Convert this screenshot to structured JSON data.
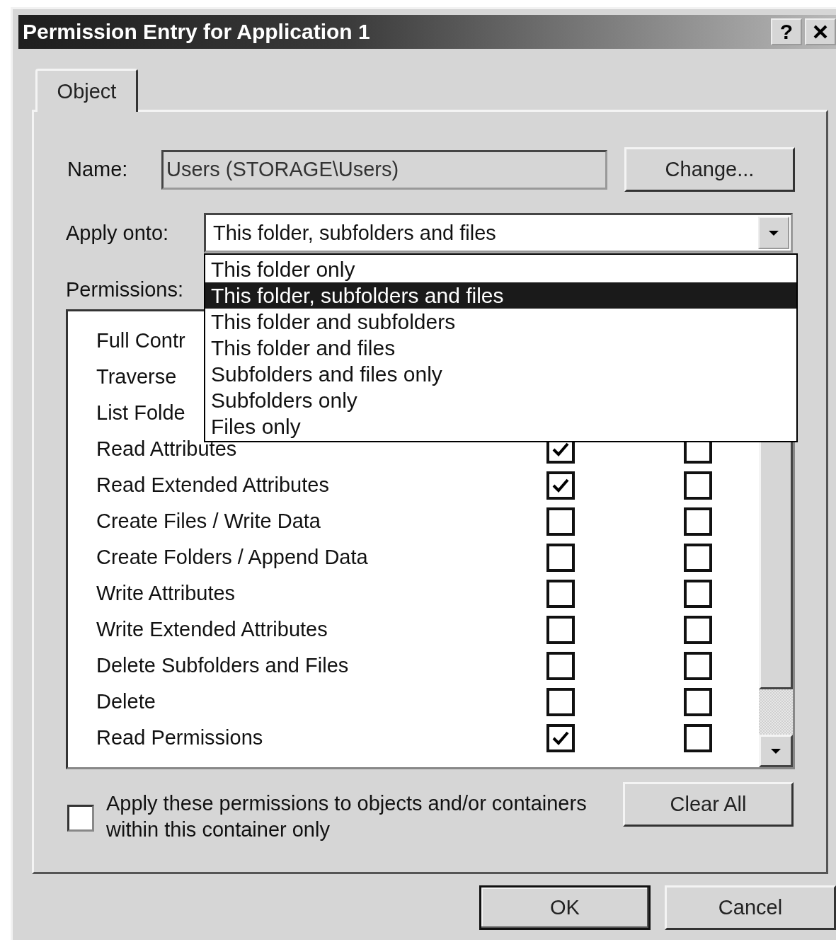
{
  "window": {
    "title": "Permission Entry for Application 1",
    "help_button": "?"
  },
  "tabs": [
    {
      "label": "Object",
      "selected": true
    }
  ],
  "name": {
    "label": "Name:",
    "value": "Users (STORAGE\\Users)",
    "button": "Change..."
  },
  "apply_onto": {
    "label": "Apply onto:",
    "value": "This folder, subfolders and files",
    "options": [
      {
        "label": "This folder only",
        "selected": false
      },
      {
        "label": "This folder, subfolders and files",
        "selected": true
      },
      {
        "label": "This folder and subfolders",
        "selected": false
      },
      {
        "label": "This folder and files",
        "selected": false
      },
      {
        "label": "Subfolders and files only",
        "selected": false
      },
      {
        "label": "Subfolders only",
        "selected": false
      },
      {
        "label": "Files only",
        "selected": false
      }
    ]
  },
  "permissions": {
    "label": "Permissions:",
    "rows": [
      {
        "label": "Full Contr"
      },
      {
        "label": "Traverse"
      },
      {
        "label": "List Folde"
      },
      {
        "label": "Read Attributes",
        "allow": true,
        "deny": false
      },
      {
        "label": "Read Extended Attributes",
        "allow": true,
        "deny": false
      },
      {
        "label": "Create Files / Write Data",
        "allow": false,
        "deny": false
      },
      {
        "label": "Create Folders / Append Data",
        "allow": false,
        "deny": false
      },
      {
        "label": "Write Attributes",
        "allow": false,
        "deny": false
      },
      {
        "label": "Write Extended Attributes",
        "allow": false,
        "deny": false
      },
      {
        "label": "Delete Subfolders and Files",
        "allow": false,
        "deny": false
      },
      {
        "label": "Delete",
        "allow": false,
        "deny": false
      },
      {
        "label": "Read Permissions",
        "allow": true,
        "deny": false
      }
    ]
  },
  "apply_checkbox": {
    "label": "Apply these permissions to objects and/or containers within this container only",
    "checked": false
  },
  "clear_button": "Clear All",
  "buttons": [
    "OK",
    "Cancel"
  ]
}
